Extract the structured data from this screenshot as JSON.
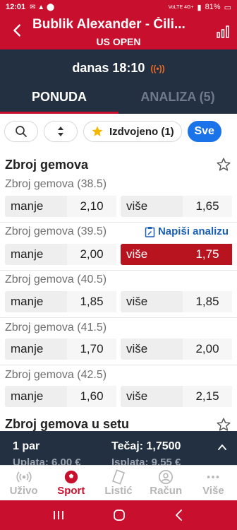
{
  "status": {
    "time": "12:01",
    "network": "VoLTE 4G+",
    "battery": "81%"
  },
  "header": {
    "title": "Bublik Alexander - Čili...",
    "subtitle": "US OPEN"
  },
  "event": {
    "time": "danas 18:10"
  },
  "tabs": [
    {
      "label": "PONUDA",
      "active": true
    },
    {
      "label": "ANALIZA (5)",
      "active": false
    }
  ],
  "filters": {
    "featured": "Izdvojeno (1)",
    "all": "Sve"
  },
  "section": {
    "title": "Zbroj gemova",
    "next_title": "Zbroj gemova u setu"
  },
  "write_analysis": "Napiši analizu",
  "markets": [
    {
      "label": "Zbroj gemova (38.5)",
      "under_label": "manje",
      "under": "2,10",
      "over_label": "više",
      "over": "1,65",
      "selected": ""
    },
    {
      "label": "Zbroj gemova (39.5)",
      "under_label": "manje",
      "under": "2,00",
      "over_label": "više",
      "over": "1,75",
      "selected": "over"
    },
    {
      "label": "Zbroj gemova (40.5)",
      "under_label": "manje",
      "under": "1,85",
      "over_label": "više",
      "over": "1,85",
      "selected": ""
    },
    {
      "label": "Zbroj gemova (41.5)",
      "under_label": "manje",
      "under": "1,70",
      "over_label": "više",
      "over": "2,00",
      "selected": ""
    },
    {
      "label": "Zbroj gemova (42.5)",
      "under_label": "manje",
      "under": "1,60",
      "over_label": "više",
      "over": "2,15",
      "selected": ""
    }
  ],
  "betslip": {
    "pairs": "1 par",
    "odds_label": "Tečaj:",
    "odds": "1,7500",
    "stake": "Uplata: 6,00 €",
    "payout": "Isplata: 9,55 €"
  },
  "nav": [
    {
      "label": "Uživo",
      "icon": "live-icon",
      "active": false
    },
    {
      "label": "Sport",
      "icon": "ball-icon",
      "active": true
    },
    {
      "label": "Listić",
      "icon": "ticket-icon",
      "active": false
    },
    {
      "label": "Račun",
      "icon": "account-icon",
      "active": false
    },
    {
      "label": "Više",
      "icon": "more-icon",
      "active": false
    }
  ],
  "colors": {
    "brand": "#c8102e",
    "dark": "#233041",
    "accent": "#1a73e8"
  }
}
